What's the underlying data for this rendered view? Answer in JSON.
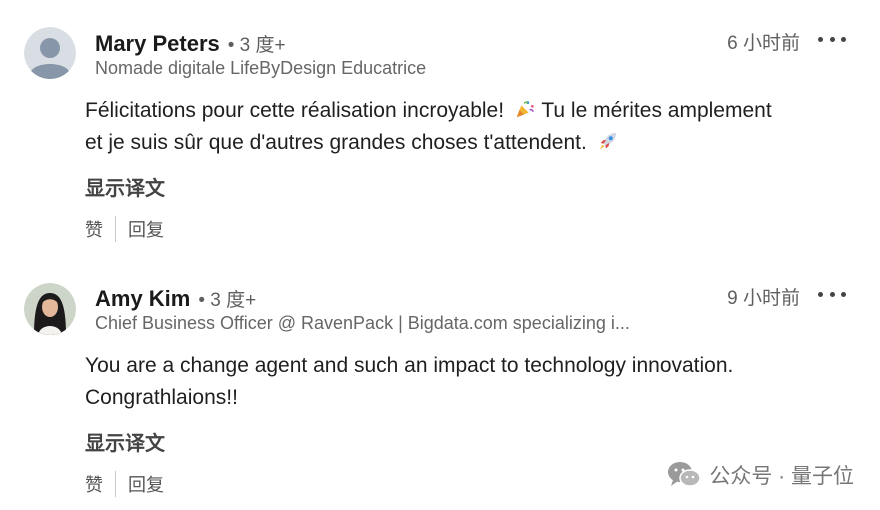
{
  "comments": [
    {
      "name": "Mary Peters",
      "degree": "• 3 度+",
      "headline": "Nomade digitale LifeByDesign Educatrice",
      "time": "6 小时前",
      "body_line1": "Félicitations pour cette réalisation incroyable!",
      "body_line1b": "Tu le mérites amplement",
      "body_line2": "et je suis sûr que d'autres grandes choses t'attendent.",
      "translate": "显示译文",
      "like": "赞",
      "reply": "回复"
    },
    {
      "name": "Amy Kim",
      "degree": "• 3 度+",
      "headline": "Chief Business Officer @ RavenPack | Bigdata.com specializing i...",
      "time": "9 小时前",
      "body_line1": "You are a change agent and such an impact to technology innovation.",
      "body_line2": "Congrathlaions!!",
      "translate": "显示译文",
      "like": "赞",
      "reply": "回复"
    }
  ],
  "watermark": {
    "text": "公众号 · 量子位"
  },
  "icons": [
    "default-avatar-icon",
    "profile-photo",
    "more-options-icon",
    "party-popper-icon",
    "rocket-icon",
    "wechat-icon"
  ]
}
